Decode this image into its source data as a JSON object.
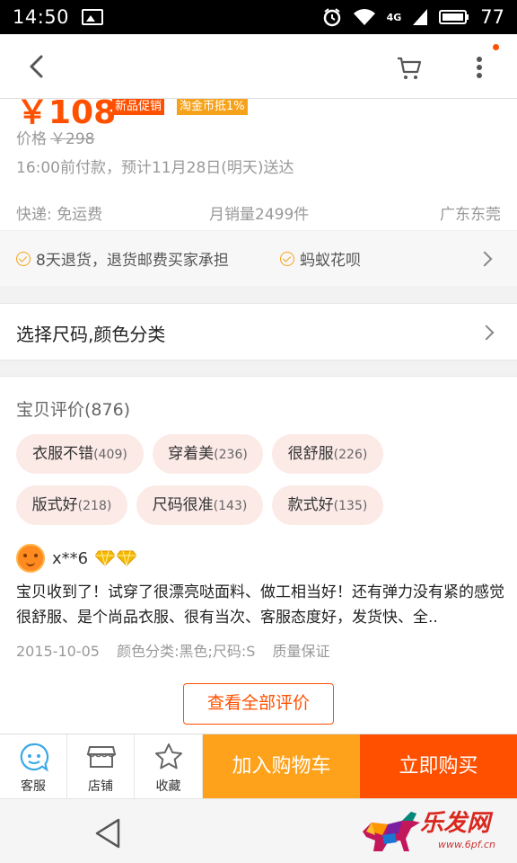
{
  "status_bar": {
    "time": "14:50",
    "network": "4G",
    "battery": "77"
  },
  "nav": {
    "back_icon": "chevron-left-icon",
    "cart_icon": "cart-icon",
    "more_icon": "more-vertical-icon"
  },
  "product": {
    "price": "￥108",
    "promo_tags": [
      "新品促销",
      "淘金币抵1%"
    ],
    "original_price_label": "价格",
    "original_price": "￥298",
    "delivery_note": "16:00前付款，预计11月28日(明天)送达",
    "shipping": "快递: 免运费",
    "monthly_sales": "月销量2499件",
    "location": "广东东莞",
    "guarantees": [
      "8天退货，退货邮费买家承担",
      "蚂蚁花呗"
    ]
  },
  "select": {
    "label": "选择尺码,颜色分类"
  },
  "reviews": {
    "title": "宝贝评价(876)",
    "tags": [
      {
        "text": "衣服不错",
        "count": "(409)"
      },
      {
        "text": "穿着美",
        "count": "(236)"
      },
      {
        "text": "很舒服",
        "count": "(226)"
      },
      {
        "text": "版式好",
        "count": "(218)"
      },
      {
        "text": "尺码很准",
        "count": "(143)"
      },
      {
        "text": "款式好",
        "count": "(135)"
      }
    ],
    "item": {
      "user": "x**6",
      "text": "宝贝收到了！试穿了很漂亮哒面料、做工相当好！还有弹力没有紧的感觉很舒服、是个尚品衣服、很有当次、客服态度好，发货快、全..",
      "date": "2015-10-05",
      "sku": "颜色分类:黑色;尺码:S",
      "quality": "质量保证"
    },
    "view_all": "查看全部评价"
  },
  "bottom_bar": {
    "service": "客服",
    "shop": "店铺",
    "favorite": "收藏",
    "add_to_cart": "加入购物车",
    "buy_now": "立即购买"
  },
  "watermark": {
    "brand": "乐发网",
    "url": "www.6pf.cn"
  },
  "colors": {
    "accent": "#ff5000",
    "secondary": "#ffa21b",
    "tag_bg": "#fbeae6"
  }
}
